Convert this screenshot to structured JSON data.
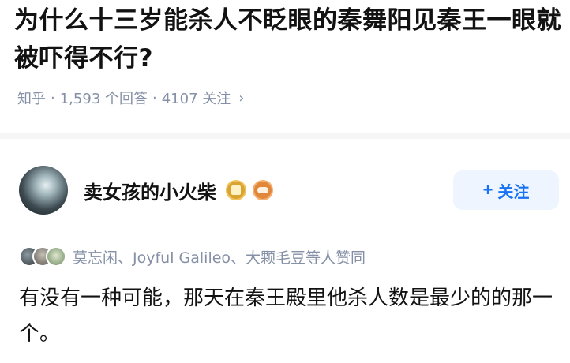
{
  "question": {
    "title": "为什么十三岁能杀人不眨眼的秦舞阳见秦王一眼就被吓得不行?",
    "meta_source": "知乎",
    "meta_answers": "1,593 个回答",
    "meta_followers": "4107 关注",
    "meta_chevron_icon": "chevron-right-icon"
  },
  "answer": {
    "author_name": "卖女孩的小火柴",
    "badges": [
      "shield-badge-icon",
      "level-badge-icon"
    ],
    "follow_label": "关注",
    "follow_icon": "plus-icon",
    "voters_text": "莫忘闲、Joyful Galileo、大颗毛豆等人赞同",
    "content": "有没有一种可能，那天在秦王殿里他杀人数是最少的的那一个。"
  },
  "colors": {
    "accent": "#1772f6",
    "follow_bg": "#eef5ff",
    "meta_text": "#8590a6",
    "title_text": "#121212"
  }
}
